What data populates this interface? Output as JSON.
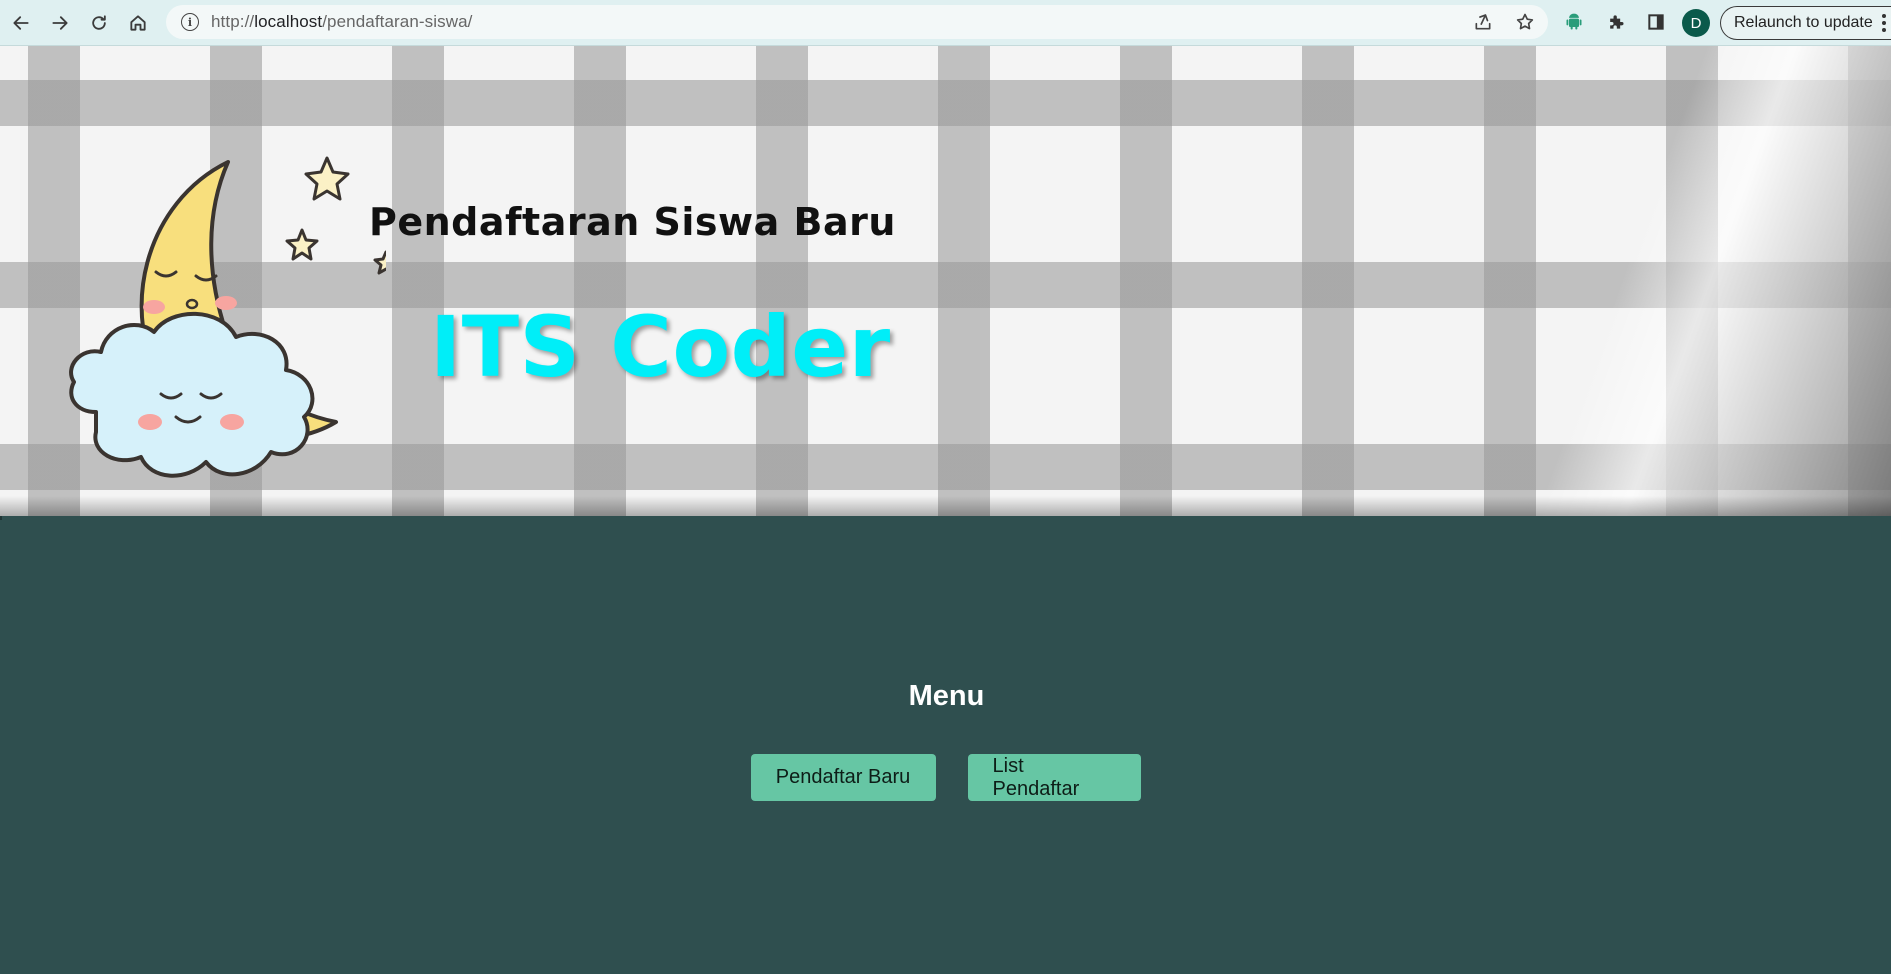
{
  "browser": {
    "url_scheme": "http://",
    "url_host": "localhost",
    "url_path": "/pendaftaran-siswa/",
    "avatar_letter": "D",
    "relaunch_label": "Relaunch to update",
    "icons": [
      "back-arrow-icon",
      "forward-arrow-icon",
      "reload-icon",
      "home-icon",
      "info-icon",
      "share-icon",
      "star-icon",
      "android-icon",
      "puzzle-icon",
      "side-panel-icon",
      "kebab-menu-icon"
    ]
  },
  "header": {
    "subtitle": "Pendaftaran Siswa Baru",
    "brand": "ITS Coder",
    "brand_color": "#00eef8"
  },
  "main": {
    "menu_title": "Menu",
    "buttons": [
      {
        "label": "Pendaftar Baru"
      },
      {
        "label": "List Pendaftar"
      }
    ],
    "background_color": "#2f4f4f",
    "button_color": "#66c6a4"
  }
}
